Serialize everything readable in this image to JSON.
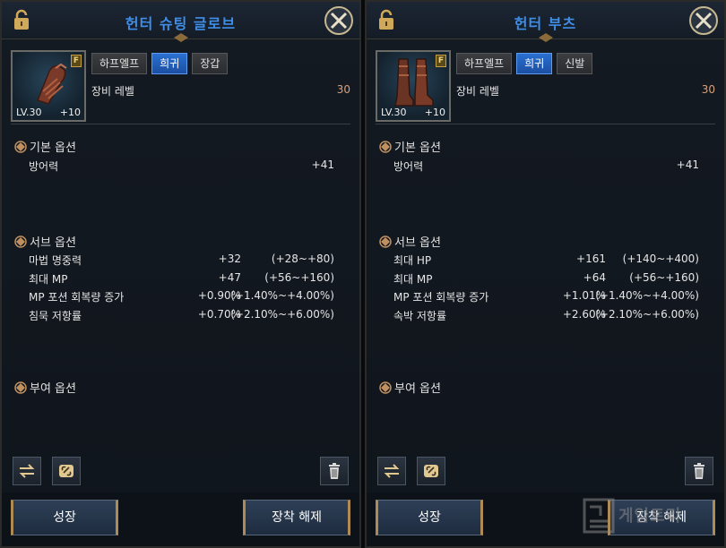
{
  "panels": [
    {
      "title": "헌터 슈팅 글로브",
      "item_kind": "gloves",
      "grade_letter": "F",
      "level": "LV.30",
      "enhance": "+10",
      "tags": [
        {
          "label": "하프엘프",
          "style": "grey"
        },
        {
          "label": "희귀",
          "style": "blue"
        },
        {
          "label": "장갑",
          "style": "grey"
        }
      ],
      "equip_level_label": "장비 레벨",
      "equip_level_value": "30",
      "basic_header": "기본 옵션",
      "basic_options": [
        {
          "name": "방어력",
          "value": "+41"
        }
      ],
      "sub_header": "서브 옵션",
      "sub_options": [
        {
          "name": "마법 명중력",
          "value": "+32",
          "range": "(+28~+80)"
        },
        {
          "name": "최대 MP",
          "value": "+47",
          "range": "(+56~+160)"
        },
        {
          "name": "MP 포션 회복량 증가",
          "value": "+0.90%",
          "range": "(+1.40%~+4.00%)"
        },
        {
          "name": "침묵 저항률",
          "value": "+0.70%",
          "range": "(+2.10%~+6.00%)"
        }
      ],
      "grant_header": "부여 옵션",
      "grow_label": "성장",
      "unequip_label": "장착 해제",
      "icons": {
        "lock": "lock-icon",
        "close": "close-icon",
        "swap": "swap-icon",
        "link": "link-icon",
        "trash": "trash-icon"
      }
    },
    {
      "title": "헌터 부츠",
      "item_kind": "boots",
      "grade_letter": "F",
      "level": "LV.30",
      "enhance": "+10",
      "tags": [
        {
          "label": "하프엘프",
          "style": "grey"
        },
        {
          "label": "희귀",
          "style": "blue"
        },
        {
          "label": "신발",
          "style": "grey"
        }
      ],
      "equip_level_label": "장비 레벨",
      "equip_level_value": "30",
      "basic_header": "기본 옵션",
      "basic_options": [
        {
          "name": "방어력",
          "value": "+41"
        }
      ],
      "sub_header": "서브 옵션",
      "sub_options": [
        {
          "name": "최대 HP",
          "value": "+161",
          "range": "(+140~+400)"
        },
        {
          "name": "최대 MP",
          "value": "+64",
          "range": "(+56~+160)"
        },
        {
          "name": "MP 포션 회복량 증가",
          "value": "+1.01%",
          "range": "(+1.40%~+4.00%)"
        },
        {
          "name": "속박 저항률",
          "value": "+2.60%",
          "range": "(+2.10%~+6.00%)"
        }
      ],
      "grant_header": "부여 옵션",
      "grow_label": "성장",
      "unequip_label": "장착 해제",
      "icons": {
        "lock": "lock-icon",
        "close": "close-icon",
        "swap": "swap-icon",
        "link": "link-icon",
        "trash": "trash-icon"
      }
    }
  ],
  "watermark": {
    "text": "게임트리"
  },
  "colors": {
    "title_blue": "#3f8ee8",
    "rare_blue": "#2a6fd0",
    "level_orange": "#d9a07a",
    "gold_trim": "#b08a55"
  }
}
